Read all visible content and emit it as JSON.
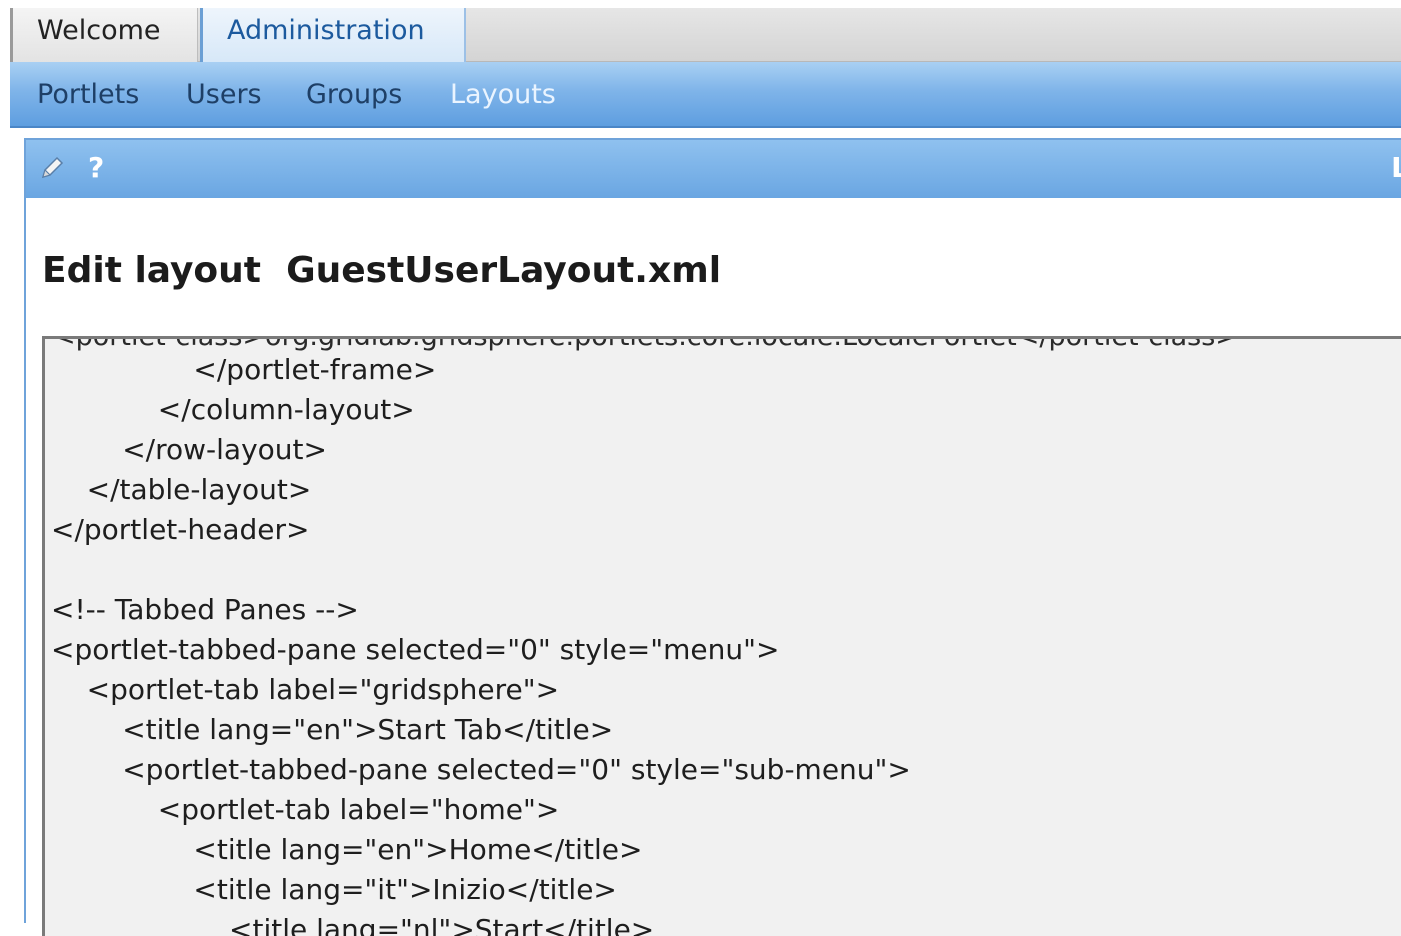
{
  "tabs": {
    "welcome": "Welcome",
    "administration": "Administration"
  },
  "submenu": {
    "portlets": "Portlets",
    "users": "Users",
    "groups": "Groups",
    "layouts": "Layouts"
  },
  "portlet": {
    "help": "?",
    "title_partial": "L",
    "heading": "Edit layout  GuestUserLayout.xml"
  },
  "editor": {
    "cut_line": "<portlet-class>org.gridlab.gridsphere.portlets.core.locale.LocalePortlet</portlet-class>",
    "lines": [
      "                </portlet-frame>",
      "            </column-layout>",
      "        </row-layout>",
      "    </table-layout>",
      "</portlet-header>",
      "",
      "<!-- Tabbed Panes -->",
      "<portlet-tabbed-pane selected=\"0\" style=\"menu\">",
      "    <portlet-tab label=\"gridsphere\">",
      "        <title lang=\"en\">Start Tab</title>",
      "        <portlet-tabbed-pane selected=\"0\" style=\"sub-menu\">",
      "            <portlet-tab label=\"home\">",
      "                <title lang=\"en\">Home</title>",
      "                <title lang=\"it\">Inizio</title>",
      "                    <title lang=\"nl\">Start</title>"
    ]
  },
  "colors": {
    "menu_blue": "#7fb4e9",
    "selected_menu_text": "#eaf4ff",
    "editor_bg": "#f1f1f1"
  }
}
